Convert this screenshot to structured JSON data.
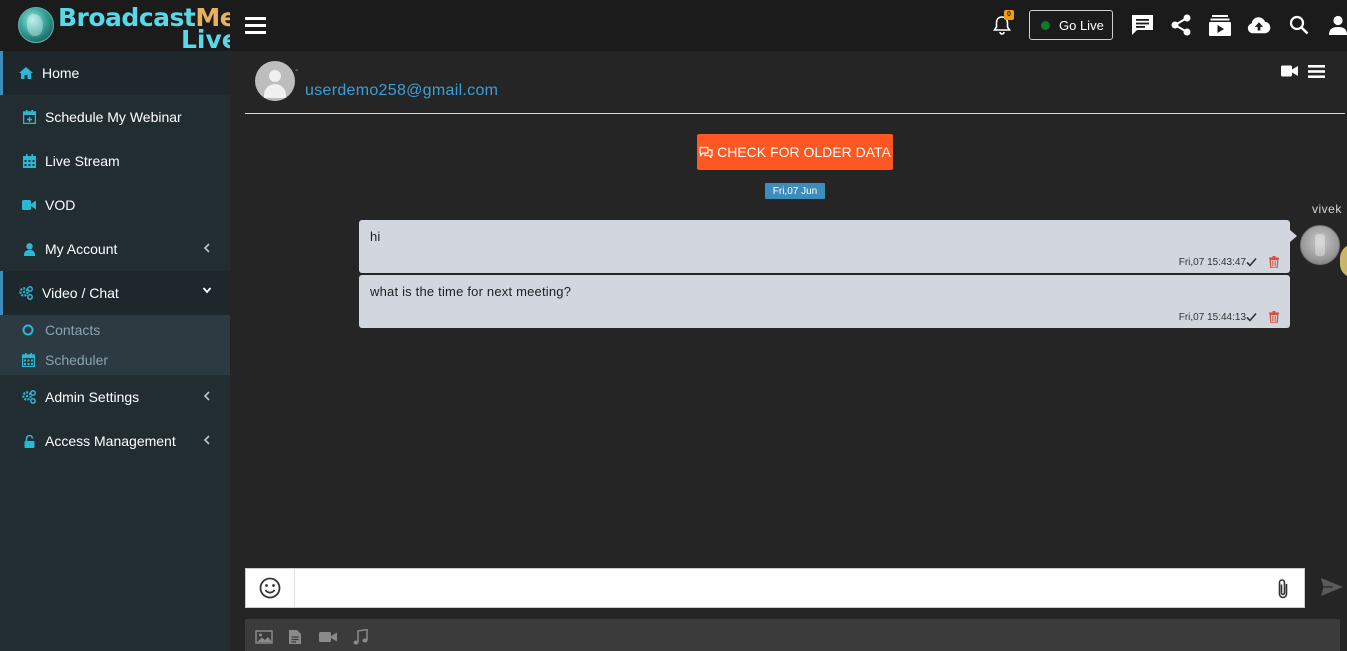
{
  "brand": {
    "name_part1": "Broadcast",
    "name_part2": "Me",
    "name_part3": "Live"
  },
  "sidebar": {
    "items": [
      {
        "label": "Home",
        "icon": "home-icon"
      },
      {
        "label": "Schedule My Webinar",
        "icon": "calendar-plus-icon"
      },
      {
        "label": "Live Stream",
        "icon": "calendar-icon"
      },
      {
        "label": "VOD",
        "icon": "video-camera-icon"
      },
      {
        "label": "My Account",
        "icon": "user-icon"
      },
      {
        "label": "Video / Chat",
        "icon": "cogs-icon"
      },
      {
        "label": "Admin Settings",
        "icon": "cogs-icon"
      },
      {
        "label": "Access Management",
        "icon": "unlock-icon"
      }
    ],
    "sub_items": [
      {
        "label": "Contacts",
        "icon": "circle-icon"
      },
      {
        "label": "Scheduler",
        "icon": "calendar-icon"
      }
    ]
  },
  "topbar": {
    "notification_count": "0",
    "golive_label": "Go Live"
  },
  "chat": {
    "contact_dash": "-",
    "contact_email": "userdemo258@gmail.com",
    "older_button": "CHECK FOR OLDER DATA",
    "date_badge": "Fri,07 Jun",
    "sender_name": "vivek",
    "messages": [
      {
        "text": "hi",
        "time": "Fri,07 15:43:47"
      },
      {
        "text": "what is the time for next meeting?",
        "time": "Fri,07 15:44:13"
      }
    ]
  },
  "input": {
    "placeholder": "",
    "value": ""
  },
  "colors": {
    "accent": "#3c8dbc",
    "button_orange": "#ff5722",
    "link_blue": "#3c9fd9",
    "sidebar_bg": "#222d32",
    "icon_cyan": "#2bb8d6"
  }
}
